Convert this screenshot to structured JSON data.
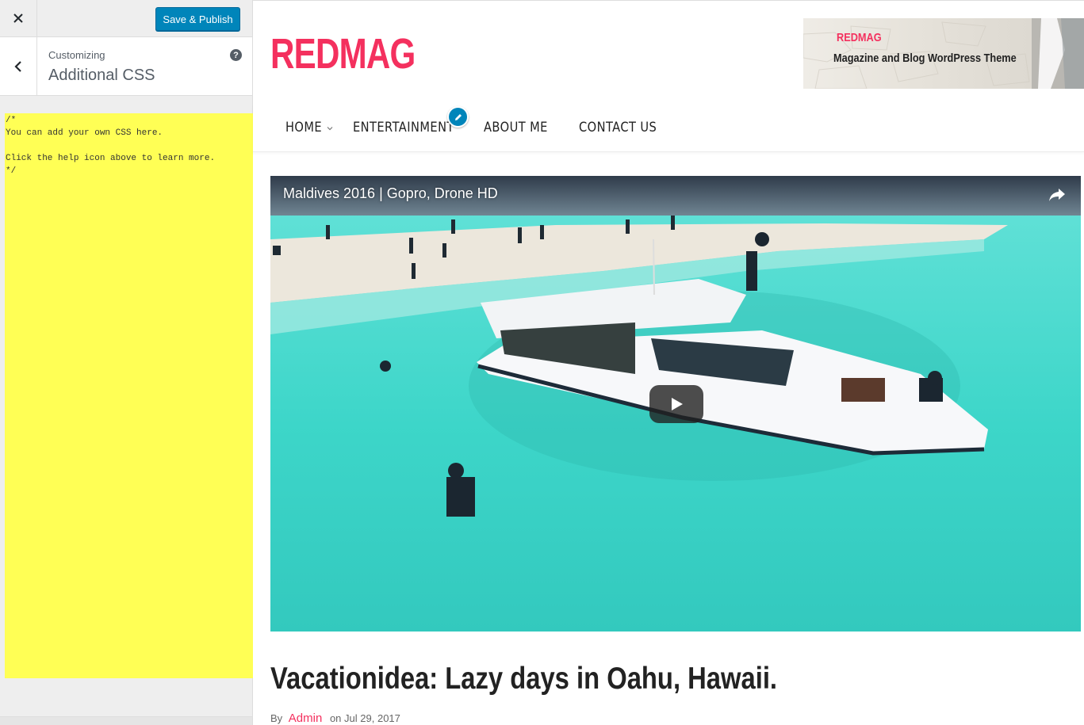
{
  "customizer": {
    "save_label": "Save & Publish",
    "crumb": "Customizing",
    "section_title": "Additional CSS",
    "help_glyph": "?",
    "css_value": "/*\nYou can add your own CSS here.\n\nClick the help icon above to learn more.\n*/",
    "editor_color": "#ffff55",
    "accent_color": "#0085ba"
  },
  "site": {
    "logo": "REDMAG",
    "banner": {
      "title": "REDMAG",
      "subtitle": "Magazine and Blog WordPress Theme"
    },
    "nav": [
      {
        "label": "HOME",
        "has_dropdown": true
      },
      {
        "label": "ENTERTAINMENT"
      },
      {
        "label": "ABOUT ME"
      },
      {
        "label": "CONTACT US"
      }
    ],
    "video": {
      "title": "Maldives 2016 | Gopro, Drone HD",
      "share_icon": "share-arrow-icon",
      "play_icon": "play-icon"
    },
    "post": {
      "title": "Vacationidea: Lazy days in Oahu, Hawaii.",
      "by": "By",
      "author": "Admin",
      "date_prefix": "on",
      "date": "Jul 29, 2017"
    },
    "brand_color": "#f4305e"
  }
}
